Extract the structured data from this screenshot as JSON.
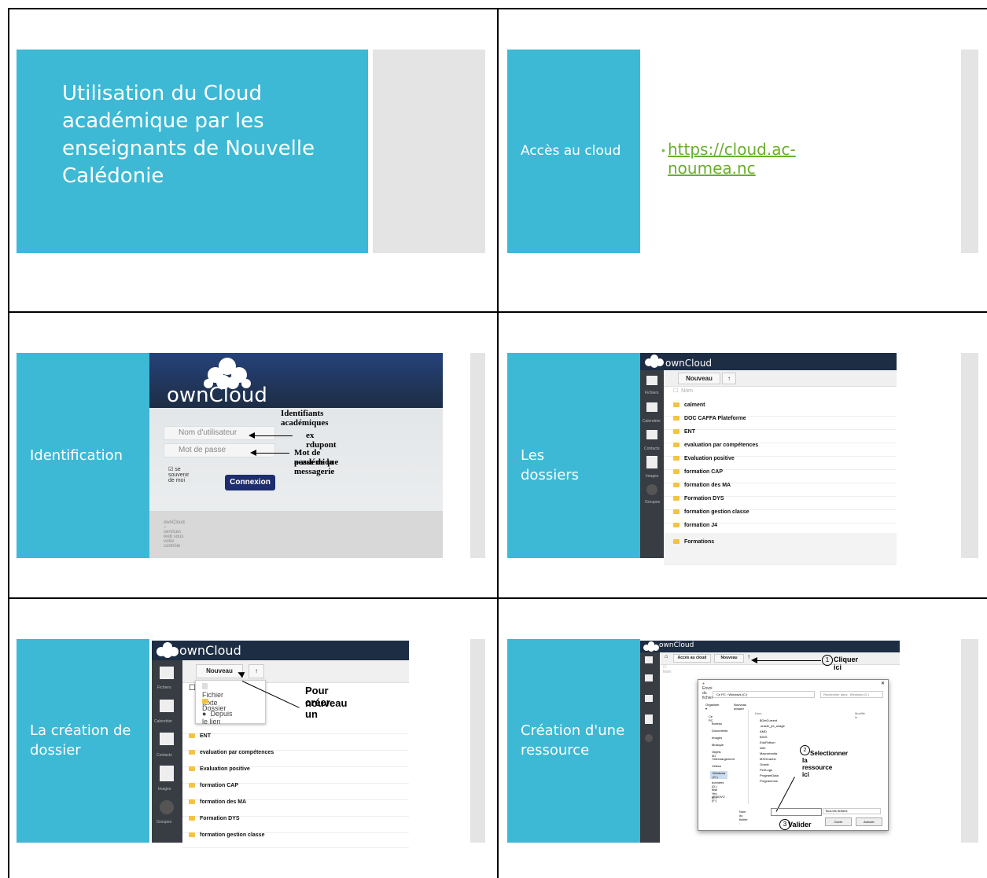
{
  "slide1": {
    "title": "Utilisation du Cloud académique par les enseignants de Nouvelle Calédonie"
  },
  "slide2": {
    "title": "Accès au cloud",
    "bullet": "•",
    "link": "https://cloud.ac-noumea.nc"
  },
  "slide3": {
    "title": "Identification",
    "logo": "ownCloud",
    "username_placeholder": "Nom d'utilisateur",
    "password_placeholder": "Mot de passe",
    "remember": "se souvenir de moi",
    "connect_button": "Connexion",
    "footer": "ownCloud – services web sous votre contrôle",
    "ann_ids": "Identifiants académiques",
    "ann_user": "ex rdupont",
    "ann_pass_1": "Mot de passe de la messagerie",
    "ann_pass_2": "académique"
  },
  "slide4": {
    "title": "Les dossiers",
    "logo": "ownCloud",
    "new_button": "Nouveau",
    "col_name": "Nom",
    "side_labels": [
      "Fichiers",
      "Calendrier",
      "Contacts",
      "Images",
      "Groupes"
    ],
    "folders": [
      "calment",
      "DOC CAFFA Plateforme",
      "ENT",
      "evaluation par compétences",
      "Evaluation positive",
      "formation CAP",
      "formation des MA",
      "Formation DYS",
      "formation gestion classe",
      "formation J4",
      "Formations"
    ]
  },
  "slide5": {
    "title": "La création de dossier",
    "logo": "ownCloud",
    "new_button": "Nouveau",
    "menu": [
      "Fichier texte",
      "Dossier",
      "Depuis le lien"
    ],
    "side_labels": [
      "Fichiers",
      "Calendrier",
      "Contacts",
      "Images",
      "Groupes"
    ],
    "partial_folder": "rme",
    "folders": [
      "ENT",
      "evaluation par compétences",
      "Evaluation positive",
      "formation CAP",
      "formation des MA",
      "Formation DYS",
      "formation gestion classe"
    ],
    "ann_1": "Pour créer un",
    "ann_2": "nouveau"
  },
  "slide6": {
    "title": "Création d'une ressource",
    "logo": "ownCloud",
    "toolbar_access": "Accès au cloud",
    "new_button": "Nouveau",
    "dialog_title": "Envoi du fichier",
    "path": "Ce PC › Windows (C:)",
    "search": "Rechercher dans : Windows (C:)",
    "organize": "Organiser ▾",
    "new_folder": "Nouveau dossier",
    "col_name": "Nom",
    "col_modified": "Modifié le",
    "tree": [
      "Ce PC",
      "Bureau",
      "Documents",
      "Images",
      "Musique",
      "Objets 3D",
      "Téléchargement",
      "Vidéos",
      "Windows (C:)",
      "donnees (D:)",
      "disk Yes (E:)",
      "LENOVO (F:)"
    ],
    "files": [
      "$GetCurrent",
      ".oracle_jre_usage",
      "AMD",
      "BIOS",
      "EduPython",
      "intel",
      "Macromedia",
      "MSOCache",
      "Oracle",
      "PerfLogs",
      "ProgramData",
      "Programmes"
    ],
    "file_name_label": "Nom du fichier :",
    "all_files": "Tous les fichiers",
    "open_btn": "Ouvrir",
    "cancel_btn": "Annuler",
    "step1": "1",
    "step1_text": "Cliquer ici",
    "step2": "2",
    "step2_text_1": "Selectionner",
    "step2_text_2": "la ressource  ici",
    "step3": "3",
    "step3_text": "Valider"
  }
}
